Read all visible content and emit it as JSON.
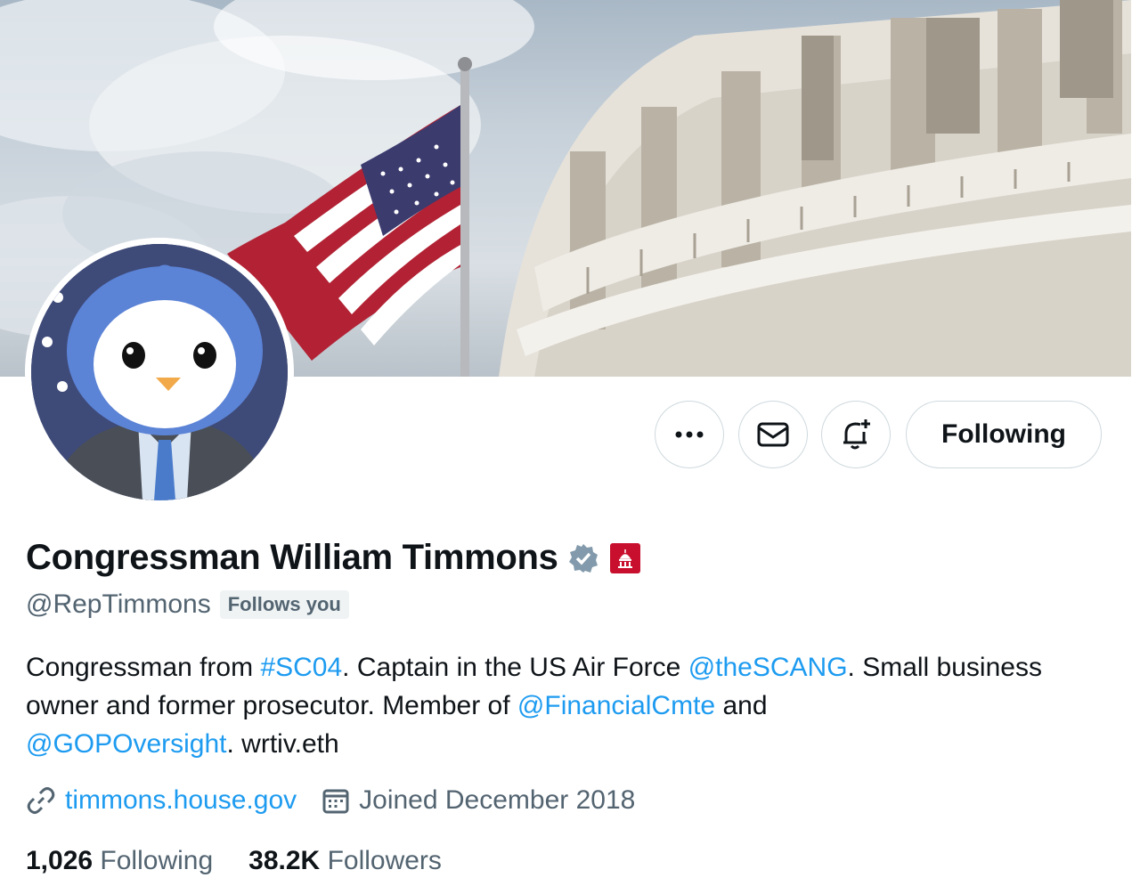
{
  "profile": {
    "name": "Congressman William Timmons",
    "handle": "@RepTimmons",
    "follows_you": "Follows you",
    "bio_parts": {
      "p1": "Congressman from ",
      "l1": "#SC04",
      "p2": ". Captain in the US Air Force ",
      "l2": "@theSCANG",
      "p3": ". Small business owner and former prosecutor. Member of ",
      "l3": "@FinancialCmte",
      "p4": " and ",
      "l4": "@GOPOversight",
      "p5": ". wrtiv.eth"
    },
    "website": "timmons.house.gov",
    "joined": "Joined December 2018",
    "following_count": "1,026",
    "following_label": "Following",
    "followers_count": "38.2K",
    "followers_label": "Followers"
  },
  "actions": {
    "following_button": "Following",
    "more_icon": "ellipsis-icon",
    "message_icon": "envelope-icon",
    "notify_icon": "bell-plus-icon"
  },
  "colors": {
    "accent": "#1d9bf0",
    "muted": "#536471",
    "text": "#0f1419",
    "verified": "#829aab",
    "gov_badge": "#c8102e"
  }
}
